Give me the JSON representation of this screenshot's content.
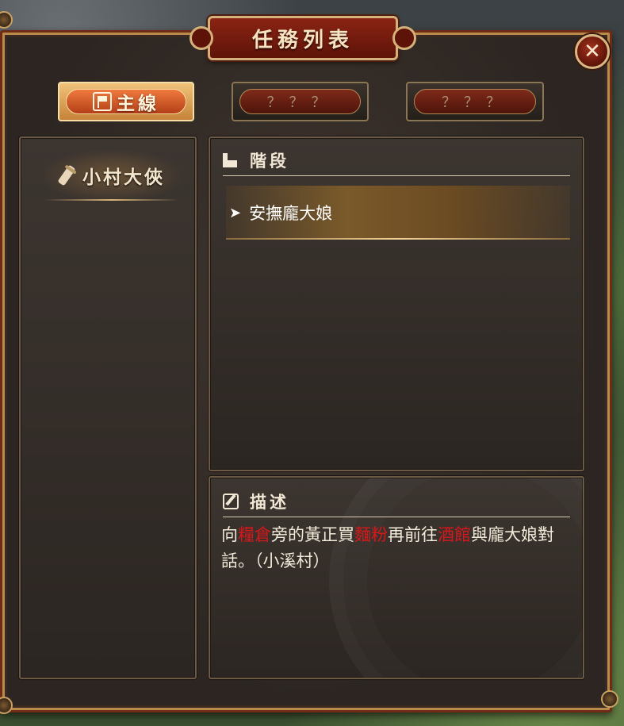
{
  "window": {
    "title": "任務列表",
    "close_label": "✕"
  },
  "tabs": [
    {
      "label": "主線",
      "active": true
    },
    {
      "label": "？？？",
      "active": false
    },
    {
      "label": "？？？",
      "active": false
    }
  ],
  "quest_list": [
    {
      "name": "小村大俠",
      "icon": "scroll-icon"
    }
  ],
  "stage_section": {
    "title": "階段",
    "icon": "stairs-icon",
    "items": [
      {
        "arrow": "➤",
        "label": "安撫龐大娘"
      }
    ]
  },
  "description_section": {
    "title": "描述",
    "icon": "edit-icon",
    "text_parts": [
      {
        "text": "向",
        "highlight": false
      },
      {
        "text": "糧倉",
        "highlight": true
      },
      {
        "text": "旁的黃正買",
        "highlight": false
      },
      {
        "text": "麵粉",
        "highlight": true
      },
      {
        "text": "再前往",
        "highlight": false
      },
      {
        "text": "酒館",
        "highlight": true
      },
      {
        "text": "與龐大娘對話。（小溪村）",
        "highlight": false
      }
    ]
  },
  "colors": {
    "highlight": "#d8171a",
    "title_plaque": "#8a2414",
    "frame_gold": "#d4b07a"
  }
}
